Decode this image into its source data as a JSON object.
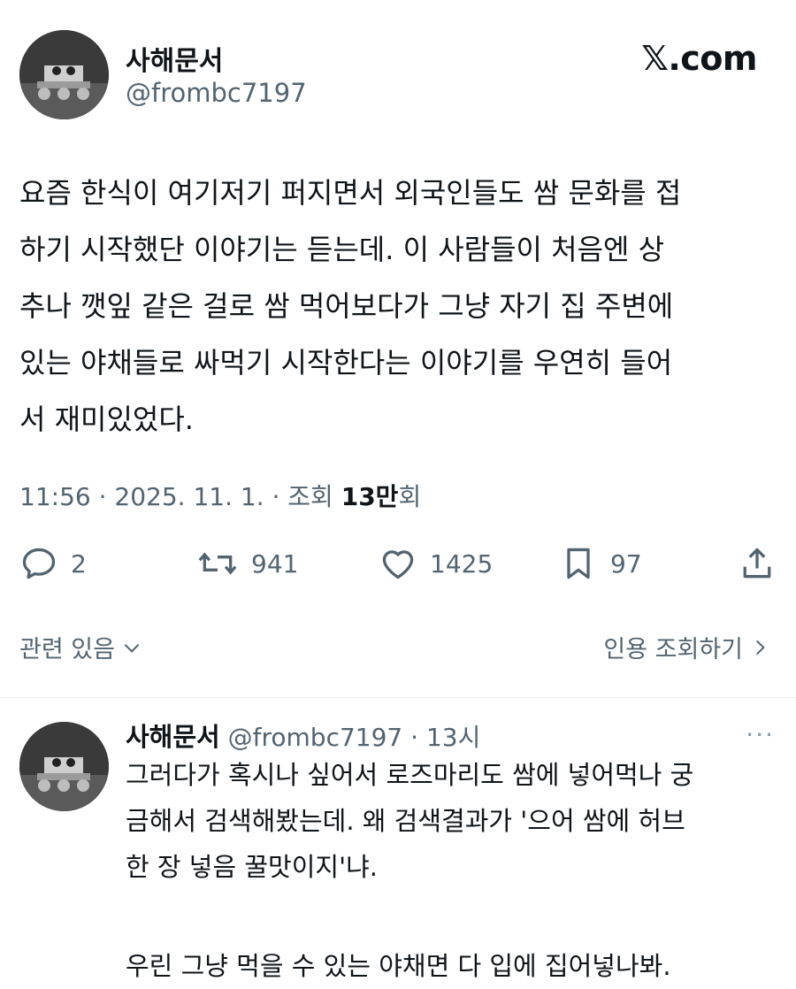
{
  "header": {
    "name": "사해문서",
    "handle": "@frombc7197",
    "logo": "𝕏.com"
  },
  "tweet": {
    "lines": [
      "요즘 한식이 여기저기 퍼지면서 외국인들도 쌈 문화를 접",
      "하기 시작했단 이야기는 듣는데. 이 사람들이 처음엔 상",
      "추나 깻잎 같은 걸로 쌈 먹어보다가 그냥 자기 집 주변에",
      "있는 야채들로 싸먹기 시작한다는 이야기를 우연히 들어",
      "서 재미있었다."
    ],
    "meta_prefix": "11:56 · 2025. 11. 1. · 조회 ",
    "views": "13만",
    "meta_suffix": "회"
  },
  "actions": {
    "replies": "2",
    "retweets": "941",
    "likes": "1425",
    "bookmarks": "97"
  },
  "related": {
    "left_label": "관련 있음",
    "right_label": "인용 조회하기"
  },
  "reply": {
    "name": "사해문서",
    "handle": "@frombc7197",
    "separator": "·",
    "time": "13시",
    "more": "···",
    "lines": [
      "그러다가 혹시나 싶어서 로즈마리도 쌈에 넣어먹나 궁",
      "금해서 검색해봤는데. 왜 검색결과가 '으어 쌈에 허브",
      "한 장 넣음 꿀맛이지'냐.",
      "",
      "우린 그냥 먹을 수 있는 야채면 다 입에 집어넣나봐."
    ]
  },
  "colors": {
    "text": "#0f1419",
    "secondary": "#536471",
    "divider": "#e6e9ec"
  },
  "icons": [
    "avatar-rover-image",
    "reply-icon",
    "retweet-icon",
    "like-icon",
    "bookmark-icon",
    "share-icon",
    "chevron-down-icon",
    "chevron-right-icon",
    "more-icon"
  ]
}
